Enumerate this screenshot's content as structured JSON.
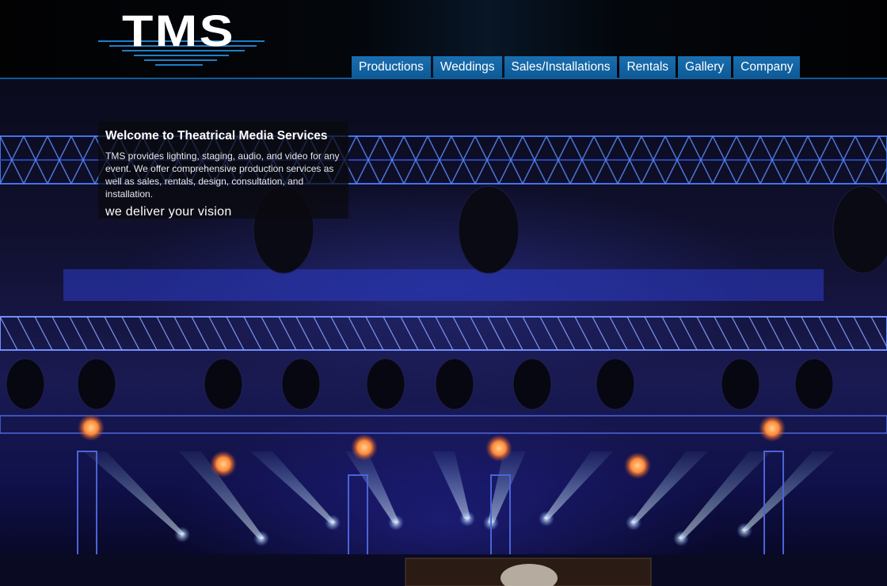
{
  "logo": {
    "text": "TMS"
  },
  "nav": {
    "items": [
      {
        "label": "Productions"
      },
      {
        "label": "Weddings"
      },
      {
        "label": "Sales/Installations"
      },
      {
        "label": "Rentals"
      },
      {
        "label": "Gallery"
      },
      {
        "label": "Company"
      }
    ]
  },
  "welcome": {
    "title": "Welcome to Theatrical Media Services",
    "body": "TMS provides lighting, staging, audio, and video for any event. We offer comprehensive production services as well as sales, rentals, design, consultation, and installation.",
    "tagline": "we deliver your vision"
  },
  "colors": {
    "nav_bg": "#1565a6",
    "header_rule": "#0d5c9a",
    "hero_blue": "#2a2ad0"
  }
}
